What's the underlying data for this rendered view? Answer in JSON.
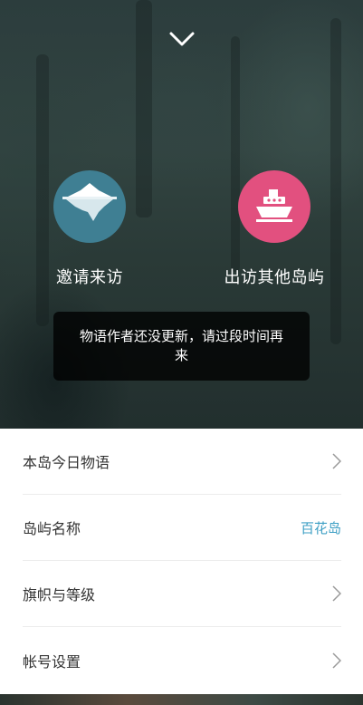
{
  "hero": {
    "invite_label": "邀请来访",
    "visit_label": "出访其他岛屿"
  },
  "toast": {
    "message": "物语作者还没更新，请过段时间再来"
  },
  "menu": {
    "items": [
      {
        "label": "本岛今日物语",
        "value": "",
        "icon": "chevron-right-icon"
      },
      {
        "label": "岛屿名称",
        "value": "百花岛",
        "icon": ""
      },
      {
        "label": "旗帜与等级",
        "value": "",
        "icon": "chevron-right-icon"
      },
      {
        "label": "帐号设置",
        "value": "",
        "icon": "chevron-right-icon"
      }
    ]
  },
  "colors": {
    "invite_circle": "#3f7f93",
    "visit_circle": "#e2507f",
    "accent_value": "#3d9fc4"
  }
}
